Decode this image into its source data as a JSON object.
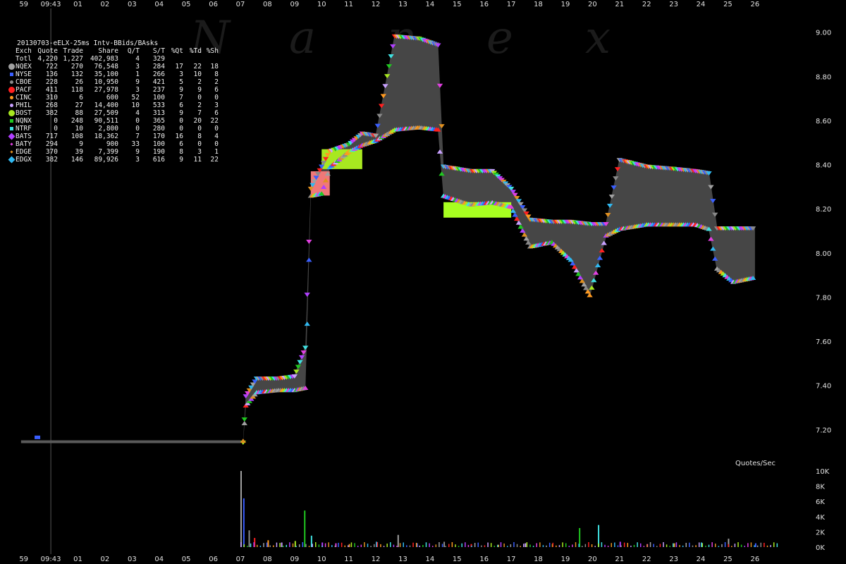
{
  "watermark": "Nanex",
  "legend": {
    "title": "20130703-eELX-25ms Intv-BBids/BAsks",
    "header": [
      "Exch",
      "Quote",
      "Trade",
      "Share",
      "Q/T",
      "S/T",
      "%Qt",
      "%Td",
      "%Sh"
    ],
    "total": [
      "Totl",
      "4,220",
      "1,227",
      "402,983",
      "4",
      "329",
      "",
      "",
      ""
    ],
    "rows": [
      {
        "exch": "NQEX",
        "color": "#a0a0a0",
        "marker": "big-dot",
        "cells": [
          "722",
          "270",
          "76,548",
          "3",
          "284",
          "17",
          "22",
          "18"
        ]
      },
      {
        "exch": "NYSE",
        "color": "#3a5fff",
        "marker": "small-sq",
        "cells": [
          "136",
          "132",
          "35,100",
          "1",
          "266",
          "3",
          "10",
          "8"
        ]
      },
      {
        "exch": "CBOE",
        "color": "#8a8a8a",
        "marker": "small-dot",
        "cells": [
          "228",
          "26",
          "10,950",
          "9",
          "421",
          "5",
          "2",
          "2"
        ]
      },
      {
        "exch": "PACF",
        "color": "#ff2020",
        "marker": "big-dot",
        "cells": [
          "411",
          "118",
          "27,978",
          "3",
          "237",
          "9",
          "9",
          "6"
        ]
      },
      {
        "exch": "CINC",
        "color": "#ff9a20",
        "marker": "small-dot",
        "cells": [
          "310",
          "6",
          "600",
          "52",
          "100",
          "7",
          "0",
          "0"
        ]
      },
      {
        "exch": "PHIL",
        "color": "#c8a0ff",
        "marker": "small-dot",
        "cells": [
          "268",
          "27",
          "14,400",
          "10",
          "533",
          "6",
          "2",
          "3"
        ]
      },
      {
        "exch": "BOST",
        "color": "#a8e820",
        "marker": "big-dot",
        "cells": [
          "382",
          "88",
          "27,509",
          "4",
          "313",
          "9",
          "7",
          "6"
        ]
      },
      {
        "exch": "NQNX",
        "color": "#20c820",
        "marker": "small-sq",
        "cells": [
          "0",
          "248",
          "90,511",
          "0",
          "365",
          "0",
          "20",
          "22"
        ]
      },
      {
        "exch": "NTRF",
        "color": "#40e0e0",
        "marker": "small-sq",
        "cells": [
          "0",
          "10",
          "2,800",
          "0",
          "280",
          "0",
          "0",
          "0"
        ]
      },
      {
        "exch": "BATS",
        "color": "#b040ff",
        "marker": "big-dia",
        "cells": [
          "717",
          "108",
          "18,362",
          "7",
          "170",
          "16",
          "8",
          "4"
        ]
      },
      {
        "exch": "BATY",
        "color": "#e040e0",
        "marker": "small-dia",
        "cells": [
          "294",
          "9",
          "900",
          "33",
          "100",
          "6",
          "0",
          "0"
        ]
      },
      {
        "exch": "EDGE",
        "color": "#e09020",
        "marker": "small-dia",
        "cells": [
          "370",
          "39",
          "7,399",
          "9",
          "190",
          "8",
          "3",
          "1"
        ]
      },
      {
        "exch": "EDGX",
        "color": "#30b8f0",
        "marker": "big-dia",
        "cells": [
          "382",
          "146",
          "89,926",
          "3",
          "616",
          "9",
          "11",
          "22"
        ]
      }
    ]
  },
  "qps_label": "Quotes/Sec",
  "chart_data": {
    "type": "line",
    "x_ticks_top": [
      "59",
      "09:43",
      "01",
      "02",
      "03",
      "04",
      "05",
      "06",
      "07",
      "08",
      "09",
      "10",
      "11",
      "12",
      "13",
      "14",
      "15",
      "16",
      "17",
      "18",
      "19",
      "20",
      "21",
      "22",
      "23",
      "24",
      "25",
      "26"
    ],
    "x_ticks_bottom": [
      "59",
      "09:43",
      "01",
      "02",
      "03",
      "04",
      "05",
      "06",
      "07",
      "08",
      "09",
      "10",
      "11",
      "12",
      "13",
      "14",
      "15",
      "16",
      "17",
      "18",
      "19",
      "20",
      "21",
      "22",
      "23",
      "24",
      "25",
      "26"
    ],
    "price_axis": {
      "ticks": [
        "9.00",
        "8.80",
        "8.60",
        "8.40",
        "8.20",
        "8.00",
        "7.80",
        "7.60",
        "7.40",
        "7.20"
      ],
      "ylim": [
        7.15,
        9.05
      ]
    },
    "volume_axis": {
      "ticks": [
        "10K",
        "8K",
        "6K",
        "4K",
        "2K",
        "0K"
      ],
      "ylim": [
        0,
        10000
      ]
    },
    "spread": [
      {
        "x": 0.0,
        "bid": 7.14,
        "ask": 7.15
      },
      {
        "x": 7.1,
        "bid": 7.14,
        "ask": 7.15
      },
      {
        "x": 7.2,
        "bid": 7.3,
        "ask": 7.36
      },
      {
        "x": 7.6,
        "bid": 7.36,
        "ask": 7.44
      },
      {
        "x": 8.4,
        "bid": 7.37,
        "ask": 7.44
      },
      {
        "x": 9.0,
        "bid": 7.37,
        "ask": 7.45
      },
      {
        "x": 9.4,
        "bid": 7.38,
        "ask": 7.58
      },
      {
        "x": 9.6,
        "bid": 8.25,
        "ask": 8.3
      },
      {
        "x": 10.0,
        "bid": 8.26,
        "ask": 8.4
      },
      {
        "x": 10.3,
        "bid": 8.38,
        "ask": 8.47
      },
      {
        "x": 11.0,
        "bid": 8.45,
        "ask": 8.5
      },
      {
        "x": 11.5,
        "bid": 8.48,
        "ask": 8.55
      },
      {
        "x": 12.0,
        "bid": 8.5,
        "ask": 8.54
      },
      {
        "x": 12.7,
        "bid": 8.55,
        "ask": 8.99
      },
      {
        "x": 13.6,
        "bid": 8.56,
        "ask": 8.98
      },
      {
        "x": 14.3,
        "bid": 8.55,
        "ask": 8.95
      },
      {
        "x": 14.5,
        "bid": 8.25,
        "ask": 8.4
      },
      {
        "x": 15.5,
        "bid": 8.21,
        "ask": 8.38
      },
      {
        "x": 16.3,
        "bid": 8.22,
        "ask": 8.38
      },
      {
        "x": 17.0,
        "bid": 8.2,
        "ask": 8.3
      },
      {
        "x": 17.7,
        "bid": 8.02,
        "ask": 8.16
      },
      {
        "x": 18.5,
        "bid": 8.04,
        "ask": 8.15
      },
      {
        "x": 19.2,
        "bid": 7.96,
        "ask": 8.15
      },
      {
        "x": 19.9,
        "bid": 7.8,
        "ask": 8.14
      },
      {
        "x": 20.5,
        "bid": 8.07,
        "ask": 8.14
      },
      {
        "x": 21.0,
        "bid": 8.1,
        "ask": 8.43
      },
      {
        "x": 22.0,
        "bid": 8.12,
        "ask": 8.4
      },
      {
        "x": 23.0,
        "bid": 8.12,
        "ask": 8.39
      },
      {
        "x": 23.8,
        "bid": 8.12,
        "ask": 8.38
      },
      {
        "x": 24.3,
        "bid": 8.1,
        "ask": 8.37
      },
      {
        "x": 24.6,
        "bid": 7.92,
        "ask": 8.12
      },
      {
        "x": 25.2,
        "bid": 7.86,
        "ask": 8.12
      },
      {
        "x": 26.0,
        "bid": 7.88,
        "ask": 8.12
      }
    ],
    "bid_fill_zones": [
      {
        "x0": 9.6,
        "x1": 10.3,
        "y0": 8.26,
        "y1": 8.37,
        "color": "#f07878",
        "name": "PACF"
      },
      {
        "x0": 10.0,
        "x1": 11.5,
        "y0": 8.38,
        "y1": 8.47,
        "color": "#a8e820",
        "name": "BOST"
      },
      {
        "x0": 14.5,
        "x1": 17.0,
        "y0": 8.16,
        "y1": 8.23,
        "color": "#a8ff20",
        "name": "BOST"
      }
    ],
    "quotes_per_sec": [
      {
        "x": 7.0,
        "v": 10000
      },
      {
        "x": 7.1,
        "v": 6400
      },
      {
        "x": 7.3,
        "v": 2200
      },
      {
        "x": 7.5,
        "v": 1200
      },
      {
        "x": 8.0,
        "v": 900
      },
      {
        "x": 8.5,
        "v": 600
      },
      {
        "x": 9.0,
        "v": 800
      },
      {
        "x": 9.35,
        "v": 4800
      },
      {
        "x": 9.6,
        "v": 1500
      },
      {
        "x": 10.0,
        "v": 600
      },
      {
        "x": 10.5,
        "v": 500
      },
      {
        "x": 11.0,
        "v": 400
      },
      {
        "x": 12.0,
        "v": 700
      },
      {
        "x": 12.8,
        "v": 1600
      },
      {
        "x": 13.5,
        "v": 500
      },
      {
        "x": 14.5,
        "v": 700
      },
      {
        "x": 15.5,
        "v": 400
      },
      {
        "x": 16.5,
        "v": 300
      },
      {
        "x": 17.5,
        "v": 500
      },
      {
        "x": 18.5,
        "v": 400
      },
      {
        "x": 19.5,
        "v": 2500
      },
      {
        "x": 20.2,
        "v": 2900
      },
      {
        "x": 21.0,
        "v": 700
      },
      {
        "x": 22.0,
        "v": 400
      },
      {
        "x": 23.0,
        "v": 500
      },
      {
        "x": 24.0,
        "v": 600
      },
      {
        "x": 25.0,
        "v": 1100
      },
      {
        "x": 26.0,
        "v": 500
      }
    ],
    "xlim": [
      -1.2,
      27.8
    ]
  }
}
